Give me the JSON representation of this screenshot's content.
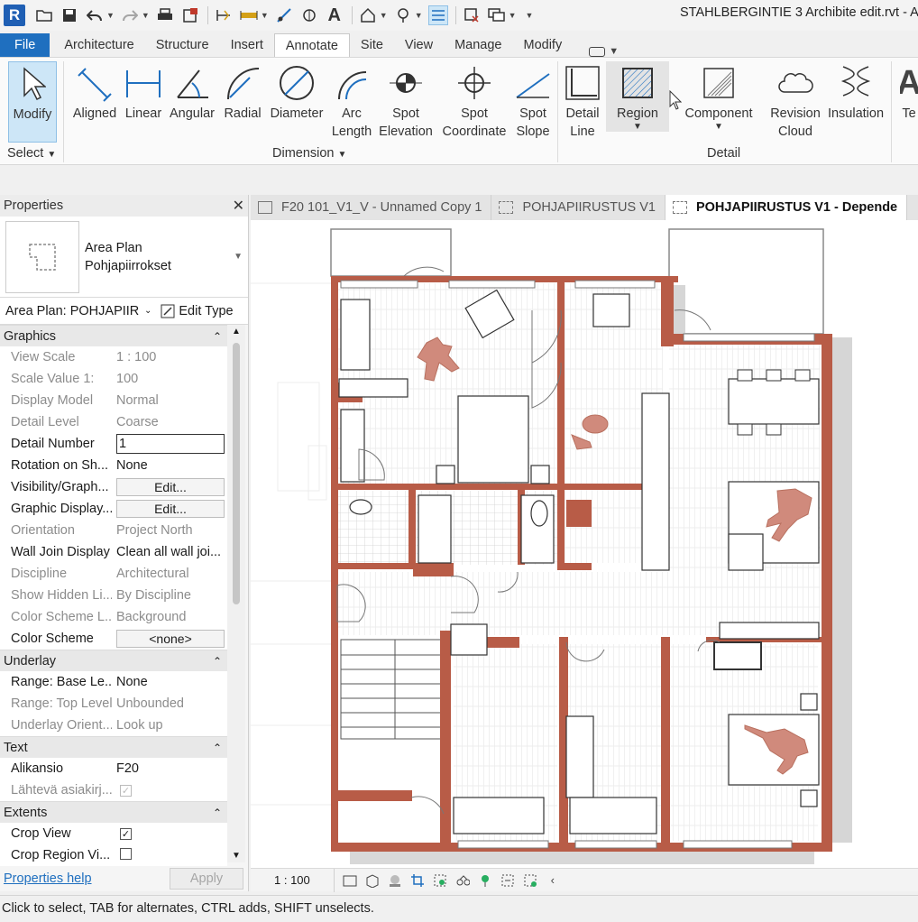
{
  "app": {
    "title": "STAHLBERGINTIE 3 Archibite edit.rvt - Ar",
    "logo": "R"
  },
  "qat": {
    "icons": [
      "open-icon",
      "save-icon",
      "undo-icon",
      "redo-icon",
      "print-icon",
      "sync-icon",
      "measure-icon",
      "dimension-icon",
      "tag-icon",
      "text-icon",
      "home-icon",
      "view-icon",
      "thin-lines-icon",
      "close-hidden-icon",
      "switch-windows-icon"
    ]
  },
  "ribbon_tabs": [
    "File",
    "Architecture",
    "Structure",
    "Insert",
    "Annotate",
    "Site",
    "View",
    "Manage",
    "Modify"
  ],
  "active_tab": "Annotate",
  "ribbon": {
    "select": {
      "tool": "Modify",
      "panel": "Select"
    },
    "dimension": {
      "panel": "Dimension",
      "tools": [
        {
          "l1": "Aligned",
          "l2": ""
        },
        {
          "l1": "Linear",
          "l2": ""
        },
        {
          "l1": "Angular",
          "l2": ""
        },
        {
          "l1": "Radial",
          "l2": ""
        },
        {
          "l1": "Diameter",
          "l2": ""
        },
        {
          "l1": "Arc",
          "l2": "Length"
        },
        {
          "l1": "Spot",
          "l2": "Elevation"
        },
        {
          "l1": "Spot",
          "l2": "Coordinate"
        },
        {
          "l1": "Spot",
          "l2": "Slope"
        }
      ]
    },
    "detail": {
      "panel": "Detail",
      "tools": [
        {
          "l1": "Detail",
          "l2": "Line"
        },
        {
          "l1": "Region",
          "l2": ""
        },
        {
          "l1": "Component",
          "l2": ""
        },
        {
          "l1": "Revision",
          "l2": "Cloud"
        },
        {
          "l1": "Insulation",
          "l2": ""
        }
      ]
    },
    "text_partial": "Te"
  },
  "properties": {
    "header": "Properties",
    "type_name": "Area Plan",
    "type_sub": "Pohjapiirrokset",
    "selector": "Area Plan: POHJAPIIRU",
    "edit_type": "Edit Type",
    "sections": [
      {
        "name": "Graphics",
        "rows": [
          {
            "k": "View Scale",
            "v": "1 : 100",
            "dis": true,
            "kind": "text"
          },
          {
            "k": "Scale Value    1:",
            "v": "100",
            "dis": true,
            "kind": "text"
          },
          {
            "k": "Display Model",
            "v": "Normal",
            "dis": true,
            "kind": "text"
          },
          {
            "k": "Detail Level",
            "v": "Coarse",
            "dis": true,
            "kind": "text"
          },
          {
            "k": "Detail Number",
            "v": "1",
            "dis": false,
            "kind": "input"
          },
          {
            "k": "Rotation on Sh...",
            "v": "None",
            "dis": false,
            "kind": "text"
          },
          {
            "k": "Visibility/Graph...",
            "v": "Edit...",
            "dis": false,
            "kind": "button"
          },
          {
            "k": "Graphic Display...",
            "v": "Edit...",
            "dis": false,
            "kind": "button"
          },
          {
            "k": "Orientation",
            "v": "Project North",
            "dis": true,
            "kind": "text"
          },
          {
            "k": "Wall Join Display",
            "v": "Clean all wall joi...",
            "dis": false,
            "kind": "text"
          },
          {
            "k": "Discipline",
            "v": "Architectural",
            "dis": true,
            "kind": "text"
          },
          {
            "k": "Show Hidden Li...",
            "v": "By Discipline",
            "dis": true,
            "kind": "text"
          },
          {
            "k": "Color Scheme L...",
            "v": "Background",
            "dis": true,
            "kind": "text"
          },
          {
            "k": "Color Scheme",
            "v": "<none>",
            "dis": false,
            "kind": "button"
          }
        ]
      },
      {
        "name": "Underlay",
        "rows": [
          {
            "k": "Range: Base Le...",
            "v": "None",
            "dis": false,
            "kind": "text"
          },
          {
            "k": "Range: Top Level",
            "v": "Unbounded",
            "dis": true,
            "kind": "text"
          },
          {
            "k": "Underlay Orient...",
            "v": "Look up",
            "dis": true,
            "kind": "text"
          }
        ]
      },
      {
        "name": "Text",
        "rows": [
          {
            "k": "Alikansio",
            "v": "F20",
            "dis": false,
            "kind": "text"
          },
          {
            "k": "Lähtevä asiakirj...",
            "v": "",
            "dis": true,
            "kind": "check-on"
          }
        ]
      },
      {
        "name": "Extents",
        "rows": [
          {
            "k": "Crop View",
            "v": "",
            "dis": false,
            "kind": "check-on"
          },
          {
            "k": "Crop Region Vi...",
            "v": "",
            "dis": false,
            "kind": "check-off"
          }
        ]
      }
    ],
    "help": "Properties help",
    "apply": "Apply"
  },
  "view_tabs": [
    {
      "label": "F20 101_V1_V - Unnamed Copy 1",
      "active": false
    },
    {
      "label": "POHJAPIIRUSTUS V1",
      "active": false
    },
    {
      "label": "POHJAPIIRUSTUS V1 - Depende",
      "active": true
    }
  ],
  "view_bar": {
    "scale": "1 : 100"
  },
  "status": "Click to select, TAB for alternates, CTRL adds, SHIFT unselects.",
  "colors": {
    "wall": "#b85c47",
    "figure": "#d08a7c",
    "file_tab": "#1f6fbf",
    "hatch": "#dcdcdc"
  }
}
